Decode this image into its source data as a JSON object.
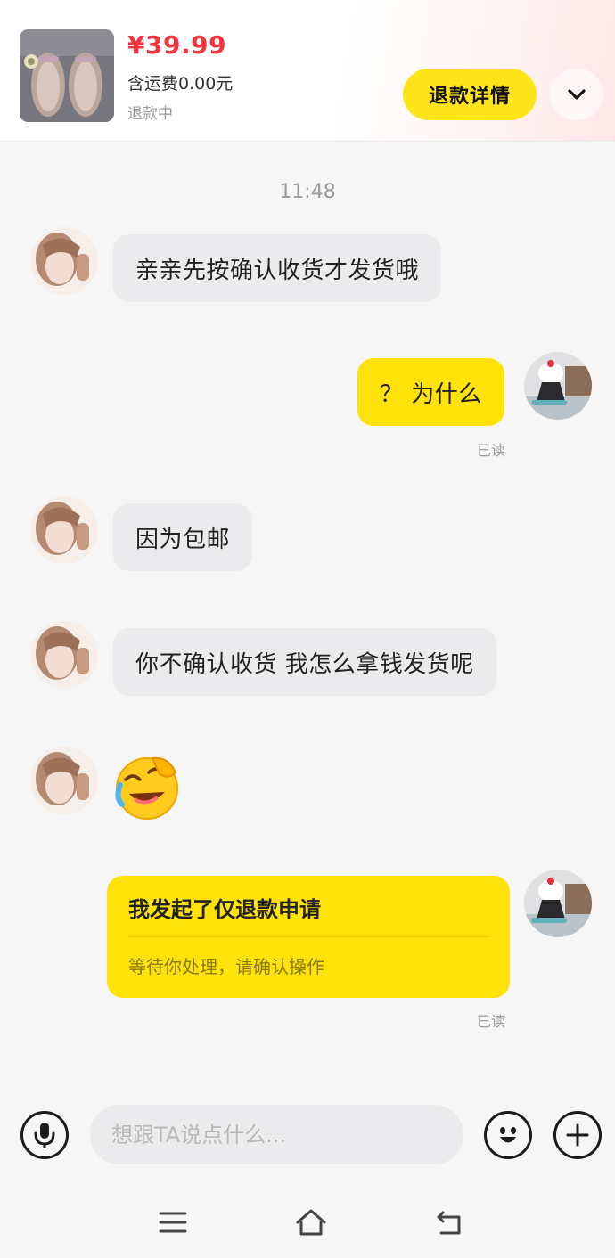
{
  "product": {
    "price": "¥39.99",
    "shipping": "含运费0.00元",
    "status": "退款中",
    "refund_details_label": "退款详情",
    "thumb_icon": "shoes-photo",
    "collapse_icon": "chevron-down-icon"
  },
  "chat": {
    "timestamp": "11:48",
    "messages": [
      {
        "from": "seller",
        "text": "亲亲先按确认收货才发货哦"
      },
      {
        "from": "me",
        "text": "？ 为什么",
        "read": "已读"
      },
      {
        "from": "seller",
        "text": "因为包邮"
      },
      {
        "from": "seller",
        "text": "你不确认收货 我怎么拿钱发货呢"
      },
      {
        "from": "seller",
        "emoji": "laughing-crying-emoji"
      },
      {
        "from": "me",
        "card": {
          "title": "我发起了仅退款申请",
          "subtitle": "等待你处理，请确认操作"
        },
        "read": "已读"
      }
    ]
  },
  "input_bar": {
    "placeholder": "想跟TA说点什么...",
    "voice_icon": "microphone-icon",
    "emoji_icon": "smiley-icon",
    "more_icon": "plus-icon"
  },
  "system_nav": {
    "menu_icon": "menu-icon",
    "home_icon": "home-icon",
    "back_icon": "back-icon"
  },
  "colors": {
    "accent_yellow": "#ffe20a",
    "price_red": "#f4333c",
    "incoming_bubble": "#ebebed",
    "background": "#f6f6f6"
  }
}
